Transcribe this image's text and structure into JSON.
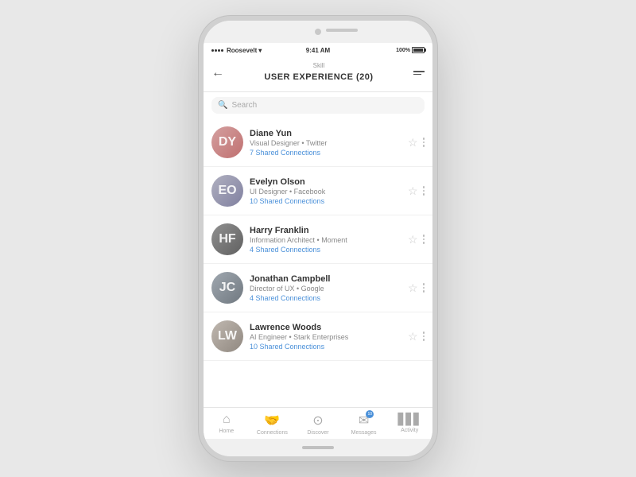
{
  "phone": {
    "status_bar": {
      "carrier": "Roosevelt",
      "time": "9:41 AM",
      "battery": "100%"
    },
    "header": {
      "skill_label": "Skill",
      "title": "USER EXPERIENCE (20)",
      "back_label": "←",
      "filter_label": "filter"
    },
    "search": {
      "placeholder": "Search"
    },
    "people": [
      {
        "name": "Diane Yun",
        "role": "Visual Designer • Twitter",
        "connections": "7 Shared Connections",
        "avatar_initials": "DY",
        "avatar_class": "avatar-1"
      },
      {
        "name": "Evelyn Olson",
        "role": "UI Designer • Facebook",
        "connections": "10 Shared Connections",
        "avatar_initials": "EO",
        "avatar_class": "avatar-2"
      },
      {
        "name": "Harry Franklin",
        "role": "Information Architect • Moment",
        "connections": "4 Shared Connections",
        "avatar_initials": "HF",
        "avatar_class": "avatar-3"
      },
      {
        "name": "Jonathan Campbell",
        "role": "Director of UX • Google",
        "connections": "4 Shared Connections",
        "avatar_initials": "JC",
        "avatar_class": "avatar-4"
      },
      {
        "name": "Lawrence Woods",
        "role": "AI Engineer • Stark Enterprises",
        "connections": "10 Shared Connections",
        "avatar_initials": "LW",
        "avatar_class": "avatar-5"
      }
    ],
    "bottom_nav": [
      {
        "label": "Home",
        "icon": "⌂"
      },
      {
        "label": "Connections",
        "icon": "🤝"
      },
      {
        "label": "Discover",
        "icon": "⊙"
      },
      {
        "label": "Messages",
        "icon": "✉",
        "badge": "10"
      },
      {
        "label": "Activity",
        "icon": "▋"
      }
    ]
  }
}
